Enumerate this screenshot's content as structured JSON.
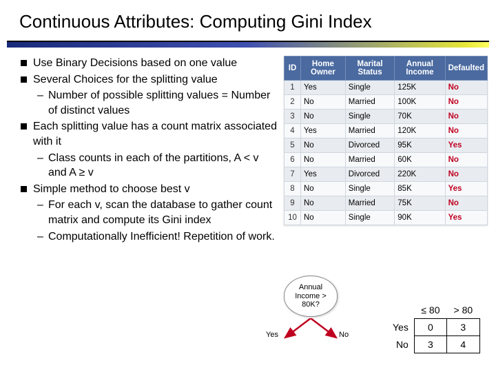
{
  "title": "Continuous Attributes: Computing Gini Index",
  "bullets": {
    "b1": "Use Binary Decisions based on one value",
    "b2": "Several Choices for the splitting value",
    "b2s1": "Number of possible splitting values = Number of distinct values",
    "b3": "Each splitting value has a count matrix associated with it",
    "b3s1": "Class counts in each of the partitions, A < v and A ≥ v",
    "b4": "Simple method to choose best v",
    "b4s1": "For each v, scan the database to gather count matrix and compute its Gini index",
    "b4s2": "Computationally Inefficient! Repetition of work."
  },
  "table": {
    "headers": {
      "id": "ID",
      "ho": "Home Owner",
      "ms": "Marital Status",
      "ai": "Annual Income",
      "df": "Defaulted"
    },
    "rows": [
      {
        "id": "1",
        "ho": "Yes",
        "ms": "Single",
        "ai": "125K",
        "df": "No"
      },
      {
        "id": "2",
        "ho": "No",
        "ms": "Married",
        "ai": "100K",
        "df": "No"
      },
      {
        "id": "3",
        "ho": "No",
        "ms": "Single",
        "ai": "70K",
        "df": "No"
      },
      {
        "id": "4",
        "ho": "Yes",
        "ms": "Married",
        "ai": "120K",
        "df": "No"
      },
      {
        "id": "5",
        "ho": "No",
        "ms": "Divorced",
        "ai": "95K",
        "df": "Yes"
      },
      {
        "id": "6",
        "ho": "No",
        "ms": "Married",
        "ai": "60K",
        "df": "No"
      },
      {
        "id": "7",
        "ho": "Yes",
        "ms": "Divorced",
        "ai": "220K",
        "df": "No"
      },
      {
        "id": "8",
        "ho": "No",
        "ms": "Single",
        "ai": "85K",
        "df": "Yes"
      },
      {
        "id": "9",
        "ho": "No",
        "ms": "Married",
        "ai": "75K",
        "df": "No"
      },
      {
        "id": "10",
        "ho": "No",
        "ms": "Single",
        "ai": "90K",
        "df": "Yes"
      }
    ]
  },
  "decision": {
    "node_text": "Annual Income > 80K?",
    "yes": "Yes",
    "no": "No"
  },
  "count_matrix": {
    "col1": "≤ 80",
    "col2": "> 80",
    "row1": "Yes",
    "row2": "No",
    "v11": "0",
    "v12": "3",
    "v21": "3",
    "v22": "4"
  }
}
